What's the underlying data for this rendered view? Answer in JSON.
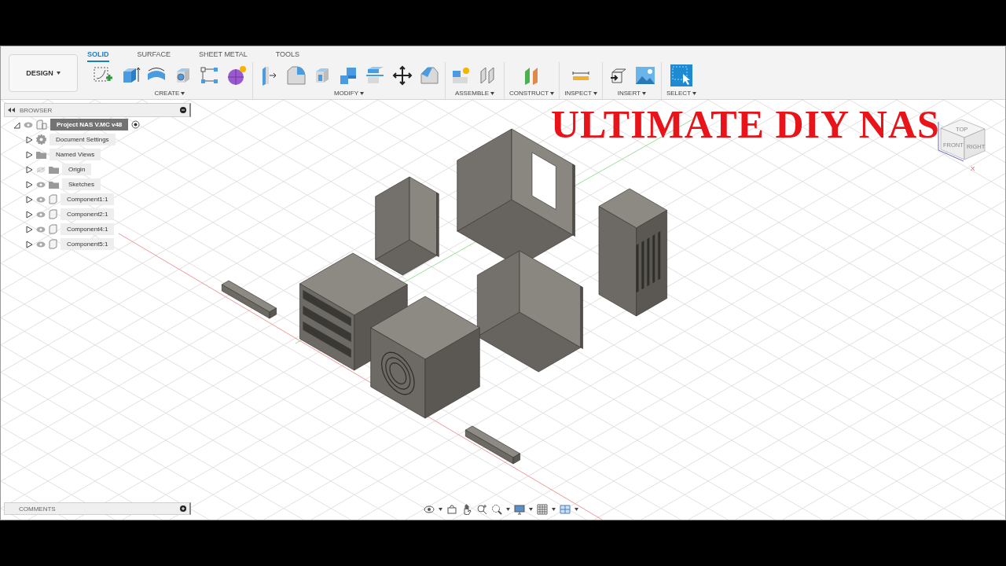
{
  "toolbar": {
    "workspace": {
      "label": "DESIGN"
    },
    "tabs": [
      {
        "label": "SOLID",
        "selected": true
      },
      {
        "label": "SURFACE",
        "selected": false
      },
      {
        "label": "SHEET METAL",
        "selected": false
      },
      {
        "label": "TOOLS",
        "selected": false
      }
    ],
    "groups": [
      {
        "label": "CREATE"
      },
      {
        "label": "MODIFY"
      },
      {
        "label": "ASSEMBLE"
      },
      {
        "label": "CONSTRUCT"
      },
      {
        "label": "INSPECT"
      },
      {
        "label": "INSERT"
      },
      {
        "label": "SELECT"
      }
    ]
  },
  "browser": {
    "title": "BROWSER",
    "root": {
      "label": "Project NAS V.MC v48",
      "selected": true,
      "expanded": true,
      "visible": true,
      "children": [
        {
          "label": "Document Settings",
          "kind": "settings",
          "expanded": false
        },
        {
          "label": "Named Views",
          "kind": "folder",
          "expanded": false
        },
        {
          "label": "Origin",
          "kind": "folder",
          "visible": false,
          "expanded": false
        },
        {
          "label": "Sketches",
          "kind": "folder",
          "visible": true,
          "expanded": false
        },
        {
          "label": "Component1:1",
          "kind": "component",
          "visible": true,
          "expanded": false
        },
        {
          "label": "Component2:1",
          "kind": "component",
          "visible": true,
          "expanded": false
        },
        {
          "label": "Component4:1",
          "kind": "component",
          "visible": true,
          "expanded": false
        },
        {
          "label": "Component5:1",
          "kind": "component",
          "visible": true,
          "expanded": false
        }
      ]
    }
  },
  "overlay_title": "ULTIMATE DIY NAS",
  "view_cube": {
    "faces": [
      "TOP",
      "FRONT",
      "RIGHT"
    ],
    "axis": "X"
  },
  "comments": {
    "title": "COMMENTS"
  }
}
